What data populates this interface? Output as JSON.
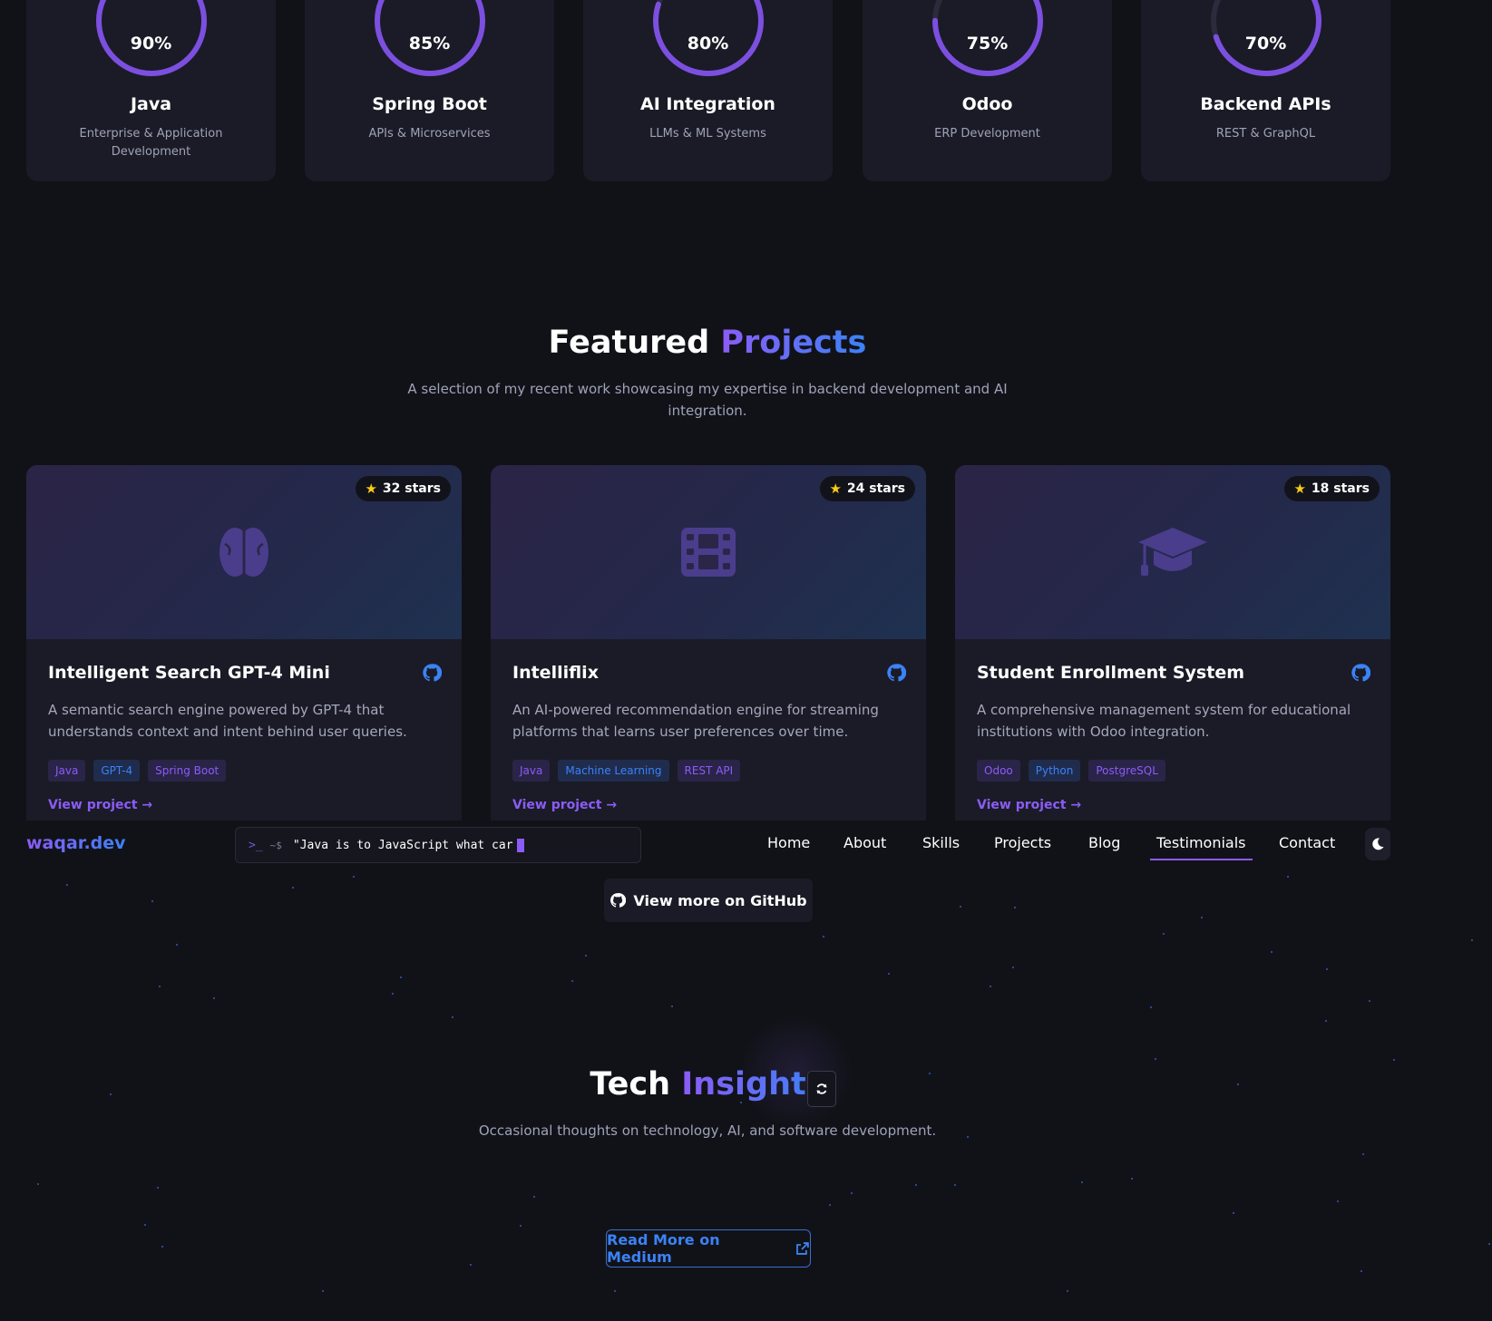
{
  "skills": [
    {
      "percent": "90%",
      "percent_value": 90,
      "name": "Java",
      "desc": "Enterprise & Application Development",
      "icon": "java-icon"
    },
    {
      "percent": "85%",
      "percent_value": 85,
      "name": "Spring Boot",
      "desc": "APIs & Microservices",
      "icon": "leaf-icon"
    },
    {
      "percent": "80%",
      "percent_value": 80,
      "name": "AI Integration",
      "desc": "LLMs & ML Systems",
      "icon": "brain-icon"
    },
    {
      "percent": "75%",
      "percent_value": 75,
      "name": "Odoo",
      "desc": "ERP Development",
      "icon": "database-icon"
    },
    {
      "percent": "70%",
      "percent_value": 70,
      "name": "Backend APIs",
      "desc": "REST & GraphQL",
      "icon": "server-icon"
    }
  ],
  "projects_section": {
    "title_plain": "Featured",
    "title_accent": "Projects",
    "subtitle": "A selection of my recent work showcasing my expertise in backend development and AI integration."
  },
  "projects": [
    {
      "stars": "32 stars",
      "title": "Intelligent Search GPT-4 Mini",
      "desc": "A semantic search engine powered by GPT-4 that understands context and intent behind user queries.",
      "tags": [
        "Java",
        "GPT-4",
        "Spring Boot"
      ],
      "link": "View project →",
      "icon": "brain-icon"
    },
    {
      "stars": "24 stars",
      "title": "Intelliflix",
      "desc": "An AI-powered recommendation engine for streaming platforms that learns user preferences over time.",
      "tags": [
        "Java",
        "Machine Learning",
        "REST API"
      ],
      "link": "View project →",
      "icon": "film-icon"
    },
    {
      "stars": "18 stars",
      "title": "Student Enrollment System",
      "desc": "A comprehensive management system for educational institutions with Odoo integration.",
      "tags": [
        "Odoo",
        "Python",
        "PostgreSQL"
      ],
      "link": "View project →",
      "icon": "graduation-cap-icon"
    }
  ],
  "navbar": {
    "logo": "waqar.dev",
    "terminal_path": "~$",
    "terminal_text": "\"Java is to JavaScript what car",
    "items": [
      "Home",
      "About",
      "Skills",
      "Projects",
      "Blog",
      "Testimonials",
      "Contact"
    ],
    "active": "Testimonials"
  },
  "github_more": "View more on GitHub",
  "insights": {
    "title_plain": "Tech",
    "title_accent": "Insights",
    "subtitle": "Occasional thoughts on technology, AI, and software development.",
    "read_more": "Read More on Medium"
  },
  "colors": {
    "accent_purple": "#8b5cf6",
    "accent_blue": "#3b82f6",
    "background": "#111218",
    "card": "#1a1b26"
  }
}
